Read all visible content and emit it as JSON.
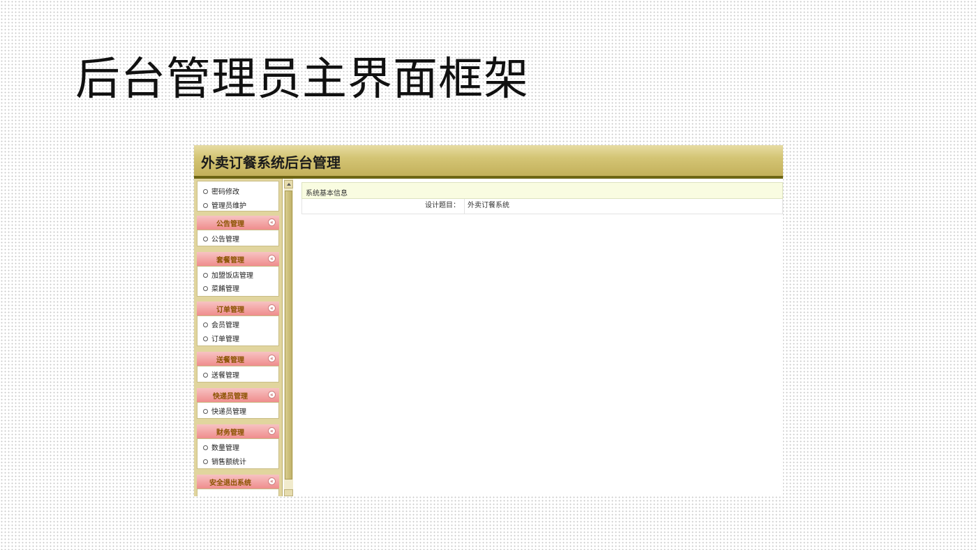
{
  "slide": {
    "title": "后台管理员主界面框架"
  },
  "app": {
    "title": "外卖订餐系统后台管理"
  },
  "sidebar": {
    "top_items": [
      "密码修改",
      "管理员维护"
    ],
    "sections": [
      {
        "title": "公告管理",
        "items": [
          "公告管理"
        ]
      },
      {
        "title": "套餐管理",
        "items": [
          "加盟饭店管理",
          "菜餚管理"
        ]
      },
      {
        "title": "订单管理",
        "items": [
          "会员管理",
          "订单管理"
        ]
      },
      {
        "title": "送餐管理",
        "items": [
          "送餐管理"
        ]
      },
      {
        "title": "快递员管理",
        "items": [
          "快递员管理"
        ]
      },
      {
        "title": "财务管理",
        "items": [
          "数量管理",
          "销售额统计"
        ]
      },
      {
        "title": "安全退出系统",
        "items": []
      }
    ],
    "collapse_glyph": "«"
  },
  "main": {
    "caption": "系统基本信息",
    "rows": [
      {
        "label": "设计题目：",
        "value": "外卖订餐系统"
      }
    ]
  }
}
